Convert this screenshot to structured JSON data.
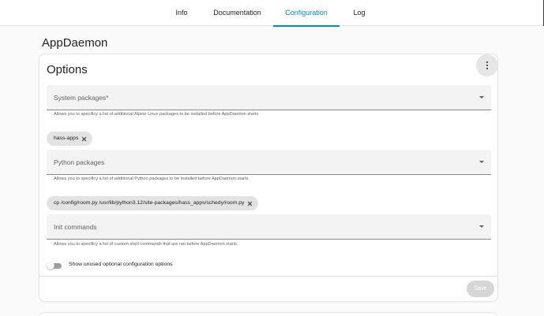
{
  "tabs": [
    {
      "label": "Info"
    },
    {
      "label": "Documentation"
    },
    {
      "label": "Configuration"
    },
    {
      "label": "Log"
    }
  ],
  "active_tab": "Configuration",
  "page_title": "AppDaemon",
  "options_card": {
    "title": "Options",
    "fields": {
      "system_packages": {
        "label": "System packages*",
        "help": "Allows you to specificy a list of additional Alpine Linux packages to be installed before AppDaemon starts.",
        "chips": [
          "hass-apps"
        ]
      },
      "python_packages": {
        "label": "Python packages",
        "help": "Allows you to specificy a list of additional Python packages to be installed before AppDaemon starts.",
        "chips": [
          "cp /config/room.py /usr/lib/python3.12/site-packages/hass_apps/schedy/room.py"
        ]
      },
      "init_commands": {
        "label": "Init commands",
        "help": "Allows you to specificy a list of custom shell commands that are ran before AppDaemon starts."
      }
    },
    "toggle_label": "Show unused optional configuration options",
    "toggle_on": false,
    "save_label": "Save"
  },
  "colors": {
    "accent": "#0288d1",
    "field_background": "#f3f3f3",
    "chip_background": "#e3e3e3",
    "save_disabled": "#d6d6d6"
  },
  "icons": [
    "more-vertical-icon",
    "dropdown-arrow-icon",
    "close-icon"
  ]
}
